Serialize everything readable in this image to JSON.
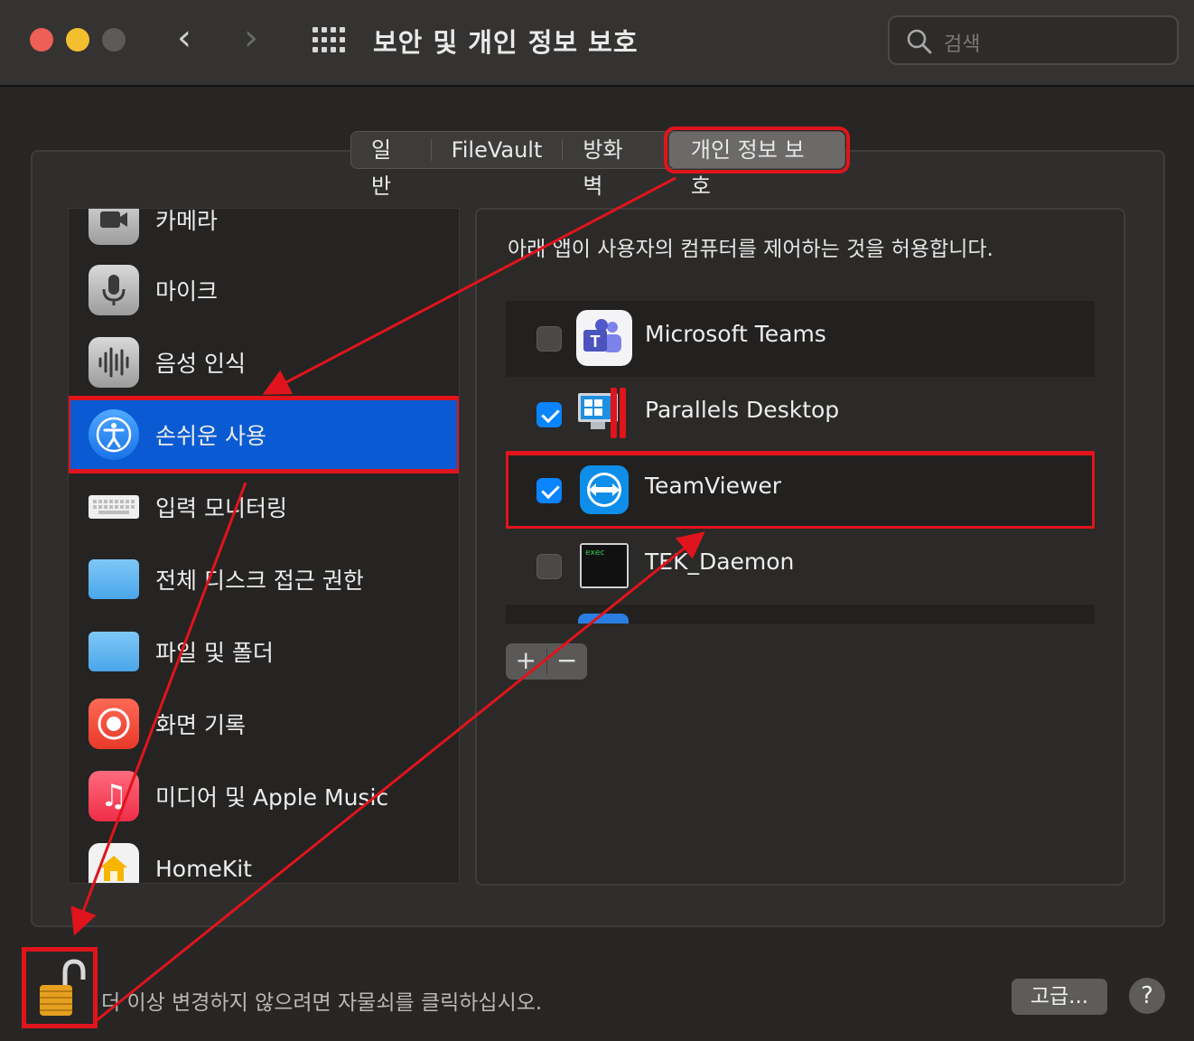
{
  "window": {
    "title": "보안 및 개인 정보 보호",
    "search_placeholder": "검색"
  },
  "tabs": [
    {
      "label": "일반"
    },
    {
      "label": "FileVault"
    },
    {
      "label": "방화벽"
    },
    {
      "label": "개인 정보 보호",
      "active": true
    }
  ],
  "sidebar": {
    "items": [
      {
        "label": "카메라",
        "icon": "camera-icon"
      },
      {
        "label": "마이크",
        "icon": "microphone-icon"
      },
      {
        "label": "음성 인식",
        "icon": "speech-recognition-icon"
      },
      {
        "label": "손쉬운 사용",
        "icon": "accessibility-icon",
        "selected": true
      },
      {
        "label": "입력 모니터링",
        "icon": "keyboard-icon"
      },
      {
        "label": "전체 디스크 접근 권한",
        "icon": "folder-icon"
      },
      {
        "label": "파일 및 폴더",
        "icon": "folder-icon"
      },
      {
        "label": "화면 기록",
        "icon": "screen-record-icon"
      },
      {
        "label": "미디어 및 Apple Music",
        "icon": "music-icon"
      },
      {
        "label": "HomeKit",
        "icon": "home-icon"
      }
    ]
  },
  "main": {
    "description": "아래 앱이 사용자의 컴퓨터를 제어하는 것을 허용합니다.",
    "apps": [
      {
        "name": "Microsoft Teams",
        "checked": false
      },
      {
        "name": "Parallels Desktop",
        "checked": true
      },
      {
        "name": "TeamViewer",
        "checked": true
      },
      {
        "name": "TEK_Daemon",
        "checked": false
      }
    ],
    "add_label": "+",
    "remove_label": "−"
  },
  "footer": {
    "lock_text": "더 이상 변경하지 않으려면 자물쇠를 클릭하십시오.",
    "advanced_label": "고급...",
    "help_label": "?"
  },
  "colors": {
    "accent": "#0a5bd3",
    "annotation": "#e0141c",
    "checkbox_on": "#0a84ff"
  }
}
